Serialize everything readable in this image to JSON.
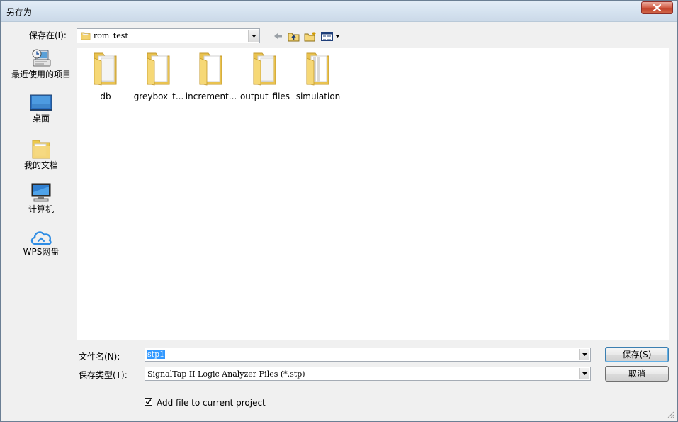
{
  "window": {
    "title": "另存为",
    "close_icon": "close-icon"
  },
  "save_in": {
    "label": "保存在(I):",
    "folder": "rom_test",
    "icon": "folder-icon"
  },
  "toolbar": {
    "back_icon": "back-arrow-icon",
    "up_icon": "up-folder-icon",
    "new_folder_icon": "new-folder-icon",
    "view_menu_icon": "view-menu-icon"
  },
  "places": [
    {
      "label": "最近使用的项目",
      "icon": "recent-items-icon"
    },
    {
      "label": "桌面",
      "icon": "desktop-icon"
    },
    {
      "label": "我的文档",
      "icon": "documents-folder-icon"
    },
    {
      "label": "计算机",
      "icon": "computer-icon"
    },
    {
      "label": "WPS网盘",
      "icon": "cloud-icon"
    }
  ],
  "files": [
    {
      "name": "db",
      "icon": "folder-icon"
    },
    {
      "name": "greybox_t...",
      "icon": "folder-icon"
    },
    {
      "name": "increment...",
      "icon": "folder-icon"
    },
    {
      "name": "output_files",
      "icon": "folder-icon"
    },
    {
      "name": "simulation",
      "icon": "folder-icon"
    }
  ],
  "filename": {
    "label": "文件名(N):",
    "value": "stp1"
  },
  "filetype": {
    "label": "保存类型(T):",
    "value": "SignalTap II Logic Analyzer Files (*.stp)"
  },
  "buttons": {
    "save": "保存(S)",
    "cancel": "取消"
  },
  "checkbox": {
    "label": "Add file to current project",
    "checked": true
  },
  "colors": {
    "accent": "#3399ff",
    "folder": "#f5d77a",
    "close": "#c1412a"
  }
}
